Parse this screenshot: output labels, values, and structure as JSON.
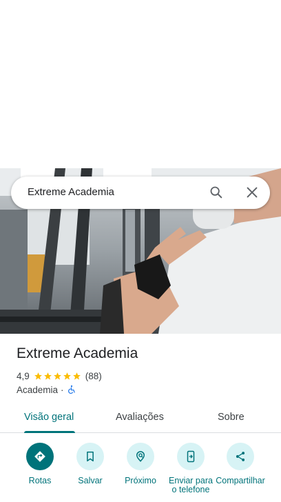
{
  "search": {
    "query": "Extreme Academia"
  },
  "place": {
    "name": "Extreme Academia",
    "rating": "4,9",
    "stars": 5,
    "review_count": "(88)",
    "category": "Academia",
    "separator": "·"
  },
  "tabs": [
    {
      "label": "Visão geral",
      "active": true
    },
    {
      "label": "Avaliações",
      "active": false
    },
    {
      "label": "Sobre",
      "active": false
    }
  ],
  "actions": [
    {
      "label": "Rotas",
      "icon": "directions-icon"
    },
    {
      "label": "Salvar",
      "icon": "bookmark-icon"
    },
    {
      "label": "Próximo",
      "icon": "nearby-icon"
    },
    {
      "label": "Enviar para o telefone",
      "icon": "send-to-phone-icon"
    },
    {
      "label": "Compartilhar",
      "icon": "share-icon"
    }
  ],
  "colors": {
    "accent": "#00737a",
    "accent_light": "#d7f3f5",
    "star": "#fbbc04",
    "accessibility": "#1a73e8"
  }
}
